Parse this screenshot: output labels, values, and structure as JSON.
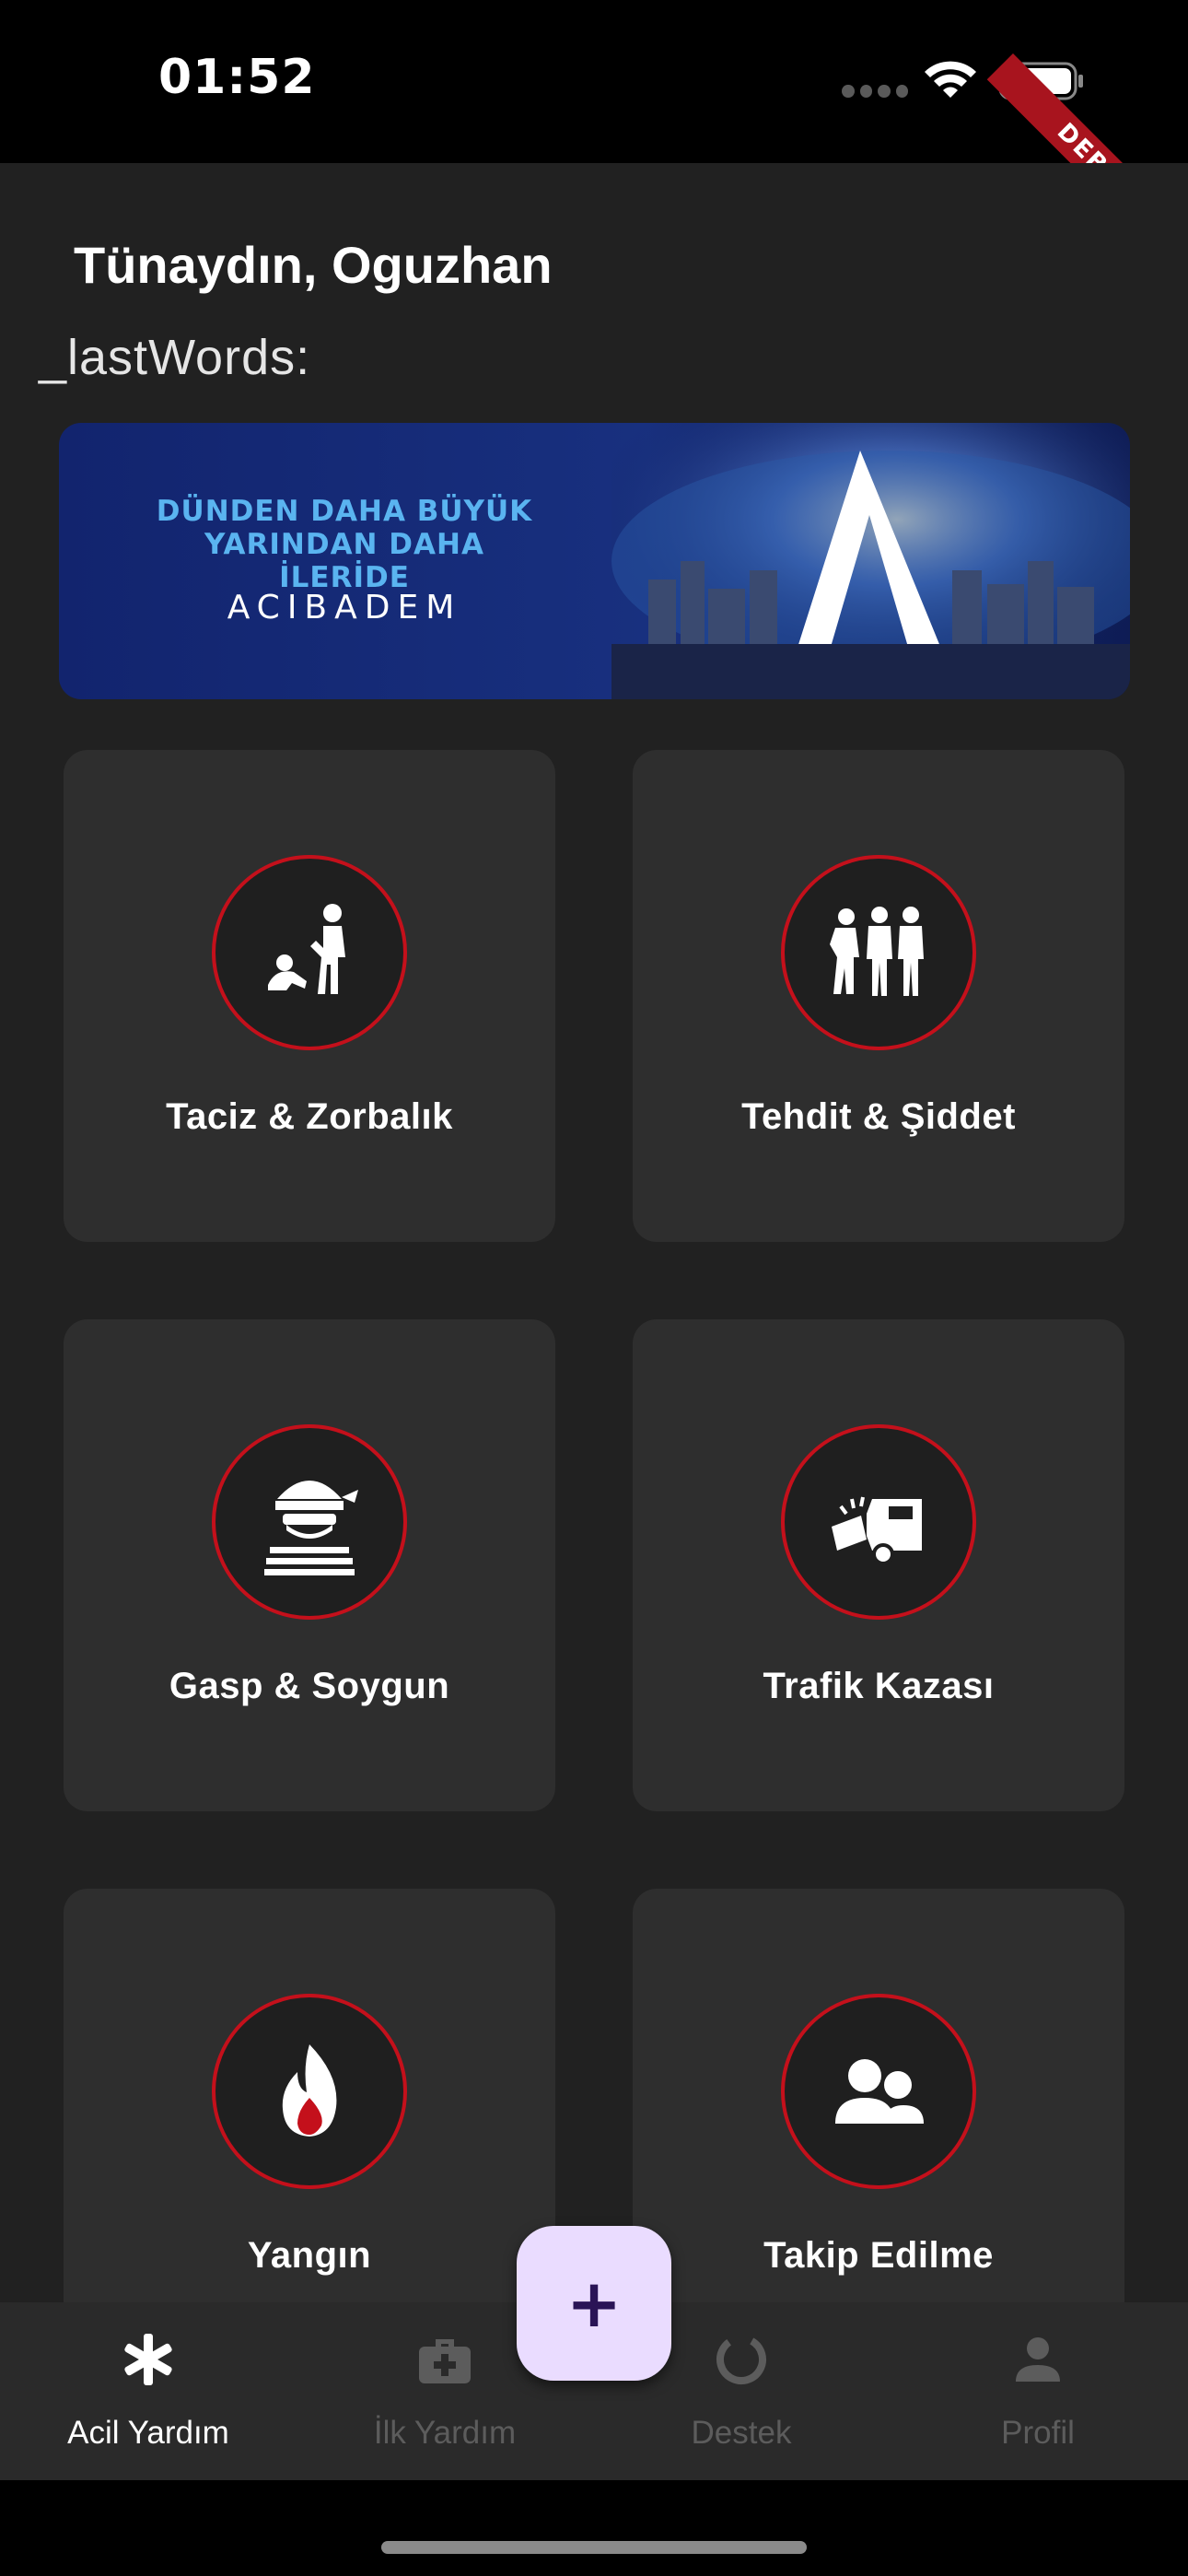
{
  "status_bar": {
    "time": "01:52",
    "debug_label": "DEBUG"
  },
  "header": {
    "greeting": "Tünaydın, Oguzhan",
    "last_words": "_lastWords:"
  },
  "banner": {
    "line1": "DÜNDEN DAHA BÜYÜK",
    "line2": "YARINDAN DAHA İLERİDE",
    "brand": "ACIBADEM"
  },
  "cards": [
    {
      "label": "Taciz & Zorbalık",
      "icon": "harassment-icon"
    },
    {
      "label": "Tehdit & Şiddet",
      "icon": "violence-icon"
    },
    {
      "label": "Gasp & Soygun",
      "icon": "robber-icon"
    },
    {
      "label": "Trafik Kazası",
      "icon": "car-crash-icon"
    },
    {
      "label": "Yangın",
      "icon": "fire-icon"
    },
    {
      "label": "Takip Edilme",
      "icon": "people-icon"
    }
  ],
  "fab": {
    "label": "+"
  },
  "bottom_nav": [
    {
      "label": "Acil Yardım",
      "icon": "asterisk-icon",
      "active": true
    },
    {
      "label": "İlk Yardım",
      "icon": "medical-kit-icon",
      "active": false
    },
    {
      "label": "Destek",
      "icon": "progress-ring-icon",
      "active": false
    },
    {
      "label": "Profil",
      "icon": "person-icon",
      "active": false
    }
  ],
  "colors": {
    "background": "#212121",
    "card": "#2e2e2e",
    "accent_red": "#c4101b",
    "fab": "#eadcff"
  }
}
